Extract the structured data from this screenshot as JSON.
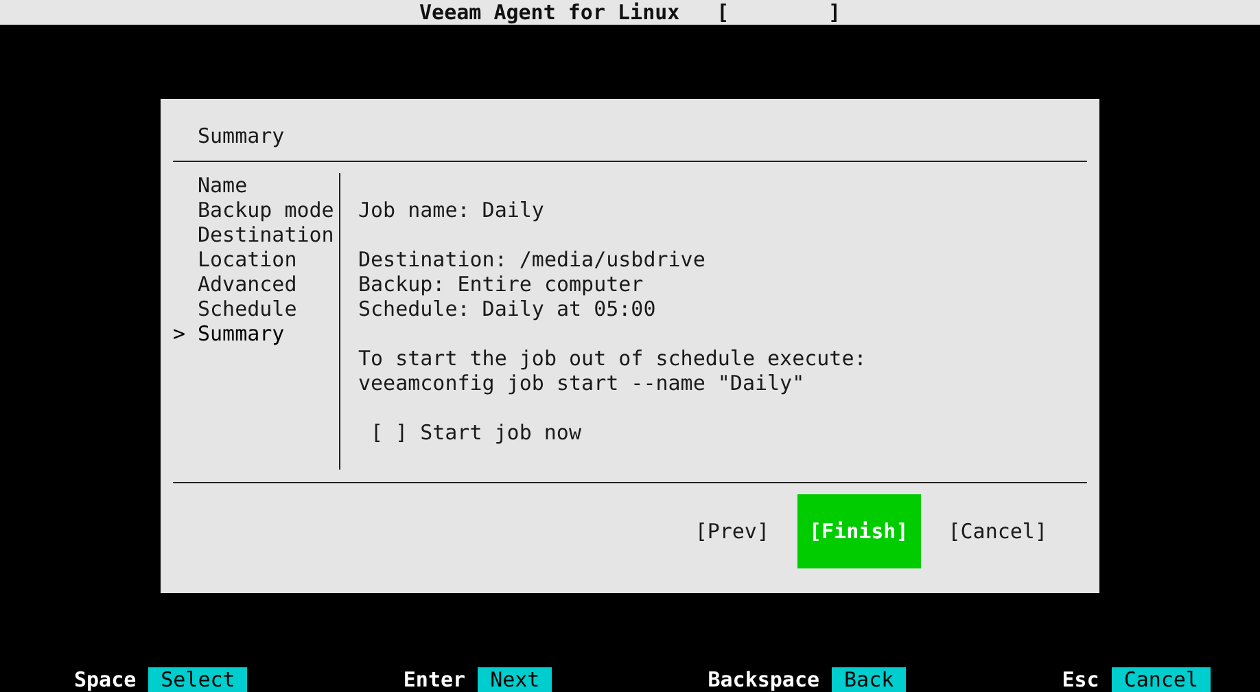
{
  "window": {
    "title": "Veeam Agent for Linux",
    "indicator": "[        ]"
  },
  "dialog": {
    "title": "Summary",
    "current_marker": ">",
    "steps": [
      {
        "label": "Name",
        "selected": false
      },
      {
        "label": "Backup mode",
        "selected": false
      },
      {
        "label": "Destination",
        "selected": false
      },
      {
        "label": "Location",
        "selected": false
      },
      {
        "label": "Advanced",
        "selected": false
      },
      {
        "label": "Schedule",
        "selected": false
      },
      {
        "label": "Summary",
        "selected": true
      }
    ],
    "summary_groups": [
      [
        "Job name: Daily"
      ],
      [
        "Destination: /media/usbdrive",
        "Backup: Entire computer",
        "Schedule: Daily at 05:00"
      ],
      [
        "To start the job out of schedule execute:",
        "veeamconfig job start --name \"Daily\""
      ]
    ],
    "checkbox": {
      "box": "[ ]",
      "label": "Start job now",
      "checked": false
    },
    "buttons": [
      {
        "label": "[Prev]",
        "selected": false
      },
      {
        "label": "[Finish]",
        "selected": true
      },
      {
        "label": "[Cancel]",
        "selected": false
      }
    ]
  },
  "key_hints": [
    {
      "key": "Space",
      "action": "Select"
    },
    {
      "key": "Enter",
      "action": "Next"
    },
    {
      "key": "Backspace",
      "action": "Back"
    },
    {
      "key": "Esc",
      "action": "Cancel"
    }
  ]
}
